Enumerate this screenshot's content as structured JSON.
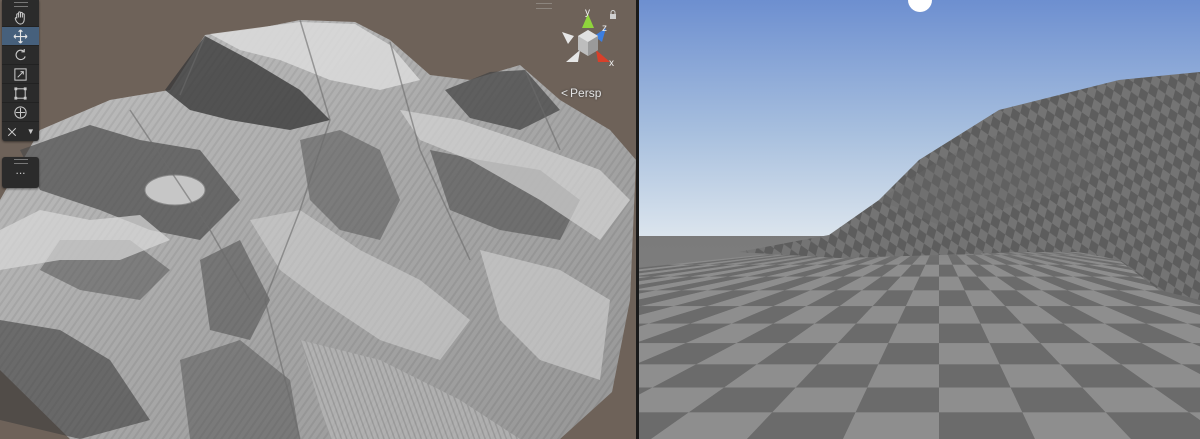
{
  "scene_view": {
    "tools": [
      {
        "name": "view-tool",
        "icon": "hand-icon",
        "active": false
      },
      {
        "name": "move-tool",
        "icon": "move-arrows-icon",
        "active": true
      },
      {
        "name": "rotate-tool",
        "icon": "rotate-icon",
        "active": false
      },
      {
        "name": "scale-tool",
        "icon": "scale-icon",
        "active": false
      },
      {
        "name": "rect-tool",
        "icon": "rect-icon",
        "active": false
      },
      {
        "name": "transform-tool",
        "icon": "transform-icon",
        "active": false
      },
      {
        "name": "custom-tools-dropdown",
        "icon": "tools-dropdown-icon",
        "active": false
      }
    ],
    "more_label": "...",
    "projection_label": "Persp",
    "gizmo": {
      "x_label": "x",
      "y_label": "y",
      "z_label": "z"
    },
    "colors": {
      "background": "#6e6259",
      "x_axis": "#d8402a",
      "y_axis": "#8fd43c",
      "z_axis": "#3c7ee0",
      "active_tool": "#46607c"
    }
  },
  "game_view": {
    "colors": {
      "sky_top": "#6d8fd0",
      "sky_horizon": "#d8e4ee",
      "checker_light": "#8e8e8e",
      "checker_dark": "#6b6b6b"
    }
  }
}
